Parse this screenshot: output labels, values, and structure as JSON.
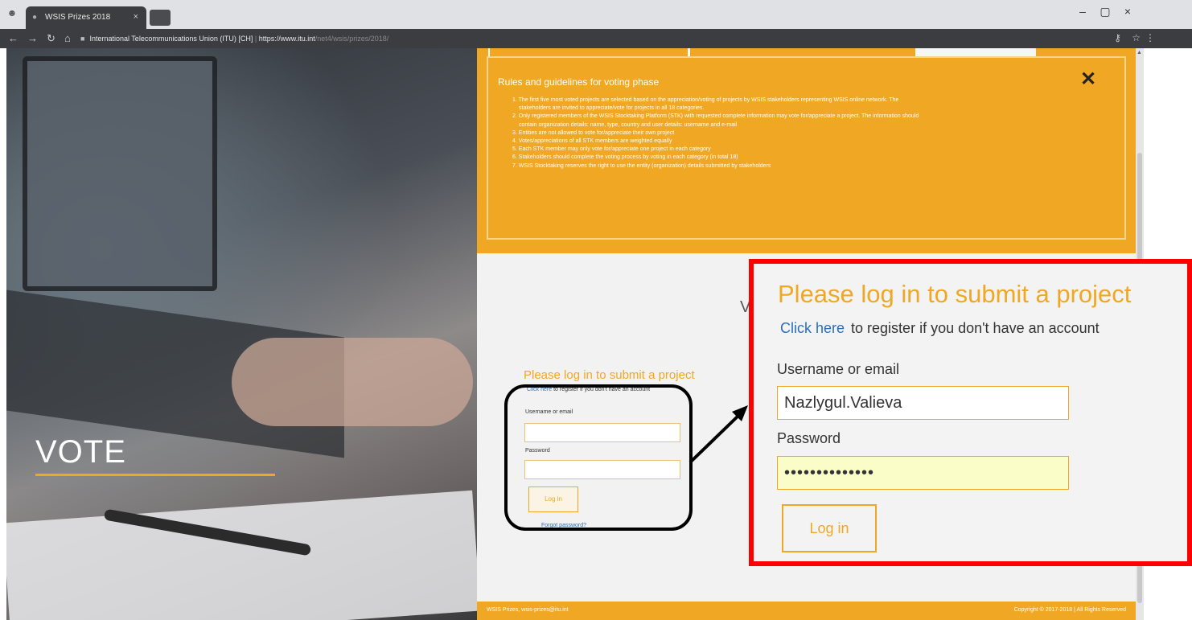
{
  "browser": {
    "tab_title": "WSIS Prizes 2018",
    "tab_close": "×",
    "site_identity": "International Telecommunications Union (ITU) [CH]",
    "url_host": "https://www.itu.int",
    "url_path": "/net4/wsis/prizes/2018/",
    "icons": [
      "app-icon",
      "back-icon",
      "forward-icon",
      "reload-icon",
      "home-icon",
      "lock-icon",
      "key-icon",
      "star-icon",
      "menu-icon"
    ]
  },
  "window_controls": {
    "minimize": "–",
    "maximize": "▢",
    "close": "×"
  },
  "hero": {
    "title": "VOTE",
    "accent_color": "#f0a824"
  },
  "rules": {
    "title": "Rules and guidelines for voting phase",
    "close_symbol": "✕",
    "items": [
      "1. The first five most voted projects are selected based on the appreciation/voting of projects by WSIS stakeholders representing WSIS online network. The",
      "stakeholders are invited to appreciate/vote for projects in all 18 categories.",
      "2. Only registered members of the WSIS Stocktaking Platform (STK) with requested complete information may vote for/appreciate a project. The information should",
      "contain organization details: name, type, country and user details: username and e-mail",
      "3. Entities are not allowed to vote for/appreciate their own project",
      "4. Votes/appreciations of all STK members are weighted equally",
      "5. Each STK member may only vote for/appreciate one project in each category",
      "6. Stakeholders should complete the voting process by voting in each category (in total 18)",
      "7. WSIS Stocktaking reserves the right to use the entity (organization) details submitted by stakeholders"
    ]
  },
  "background_heading_fragment": "V",
  "small_login": {
    "title": "Please log in to submit a project",
    "register_link": "Click here",
    "register_text": "to register if you don't have an account",
    "username_label": "Username or email",
    "password_label": "Password",
    "login_button": "Log in",
    "forgot_password": "Forgot password?"
  },
  "zoom_login": {
    "title": "Please log in to submit a project",
    "register_link": "Click here",
    "register_text": "to register if you don't have an account",
    "username_label": "Username or email",
    "username_value": "Nazlygul.Valieva",
    "password_label": "Password",
    "password_value": "••••••••••••••",
    "login_button": "Log in"
  },
  "footer": {
    "left": "WSIS Prizes, wsis-prizes@itu.int",
    "right": "Copyright © 2017-2018 | All Rights Reserved"
  },
  "colors": {
    "accent": "#f0a824",
    "link": "#2a6ebb",
    "highlight_border": "#ff0000",
    "annotation": "#000000",
    "autofill": "#fbfdc8"
  }
}
